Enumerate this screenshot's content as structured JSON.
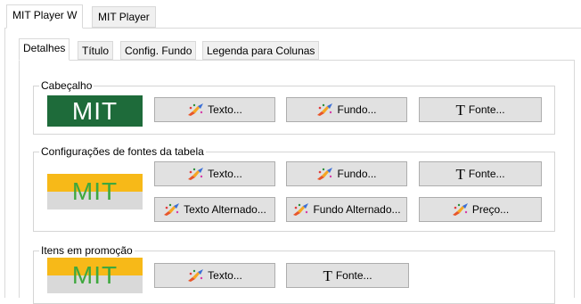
{
  "outer_tabs": [
    {
      "label": "MIT Player W",
      "active": true
    },
    {
      "label": "MIT Player",
      "active": false
    }
  ],
  "inner_tabs": [
    {
      "label": "Detalhes",
      "active": true
    },
    {
      "label": "Título",
      "active": false
    },
    {
      "label": "Config. Fundo",
      "active": false
    },
    {
      "label": "Legenda para Colunas",
      "active": false
    }
  ],
  "groups": {
    "header": {
      "title": "Cabeçalho",
      "preview": {
        "text": "MIT",
        "bg": "#1e6b3a",
        "fg": "#ffffff"
      },
      "buttons": {
        "texto": "Texto...",
        "fundo": "Fundo...",
        "fonte": "Fonte..."
      }
    },
    "table": {
      "title": "Configurações de fontes da tabela",
      "preview": {
        "text": "MIT",
        "top_color": "#f7b918",
        "bottom_color": "#d9d9d9",
        "fg": "#3ea83e"
      },
      "buttons": {
        "texto": "Texto...",
        "fundo": "Fundo...",
        "fonte": "Fonte...",
        "texto_alternado": "Texto Alternado...",
        "fundo_alternado": "Fundo Alternado...",
        "preco": "Preço..."
      }
    },
    "promo": {
      "title": "Itens em promoção",
      "preview": {
        "text": "MIT",
        "top_color": "#f7b918",
        "bottom_color": "#d9d9d9",
        "fg": "#3ea83e"
      },
      "buttons": {
        "texto": "Texto...",
        "fonte": "Fonte..."
      }
    }
  },
  "icons": {
    "brush": "paint-brush-icon",
    "font": "font-T-icon"
  }
}
